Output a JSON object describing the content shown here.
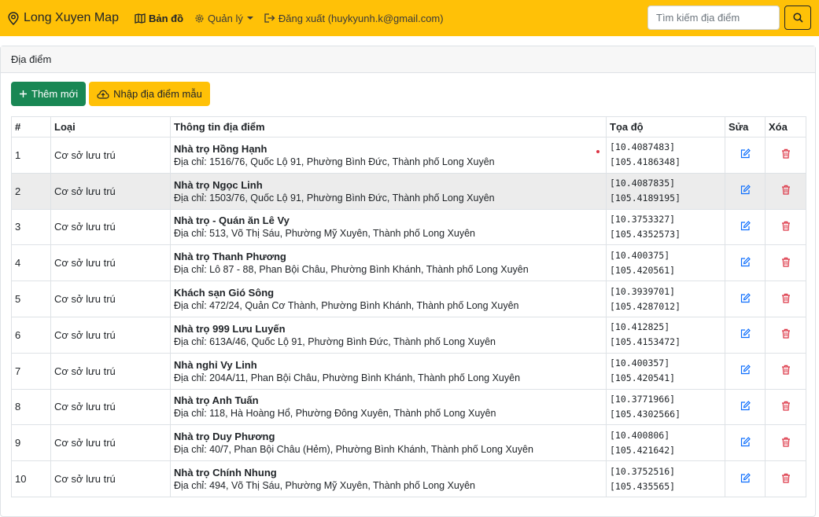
{
  "navbar": {
    "brand": "Long Xuyen Map",
    "map_label": "Bản đồ",
    "manage_label": "Quản lý",
    "logout_label": "Đăng xuất (huykyunh.k@gmail.com)",
    "search_placeholder": "Tìm kiếm địa điểm"
  },
  "card": {
    "title": "Địa điểm",
    "add_label": "Thêm mới",
    "import_label": "Nhập địa điểm mẫu"
  },
  "table": {
    "headers": [
      "#",
      "Loại",
      "Thông tin địa điểm",
      "Tọa độ",
      "Sửa",
      "Xóa"
    ],
    "rows": [
      {
        "no": "1",
        "type": "Cơ sở lưu trú",
        "name": "Nhà trọ Hồng Hạnh",
        "address": "Địa chỉ: 1516/76, Quốc Lộ 91, Phường Bình Đức, Thành phố Long Xuyên",
        "lat": "[10.4087483]",
        "lng": "[105.4186348]"
      },
      {
        "no": "2",
        "type": "Cơ sở lưu trú",
        "name": "Nhà trọ Ngọc Linh",
        "address": "Địa chỉ: 1503/76, Quốc Lộ 91, Phường Bình Đức, Thành phố Long Xuyên",
        "lat": "[10.4087835]",
        "lng": "[105.4189195]"
      },
      {
        "no": "3",
        "type": "Cơ sở lưu trú",
        "name": "Nhà trọ - Quán ăn Lê Vy",
        "address": "Địa chỉ: 513, Võ Thị Sáu, Phường Mỹ Xuyên, Thành phố Long Xuyên",
        "lat": "[10.3753327]",
        "lng": "[105.4352573]"
      },
      {
        "no": "4",
        "type": "Cơ sở lưu trú",
        "name": "Nhà trọ Thanh Phương",
        "address": "Địa chỉ: Lô 87 - 88, Phan Bội Châu, Phường Bình Khánh, Thành phố Long Xuyên",
        "lat": "[10.400375]",
        "lng": "[105.420561]"
      },
      {
        "no": "5",
        "type": "Cơ sở lưu trú",
        "name": "Khách sạn Gió Sông",
        "address": "Địa chỉ: 472/24, Quản Cơ Thành, Phường Bình Khánh, Thành phố Long Xuyên",
        "lat": "[10.3939701]",
        "lng": "[105.4287012]"
      },
      {
        "no": "6",
        "type": "Cơ sở lưu trú",
        "name": "Nhà trọ 999 Lưu Luyến",
        "address": "Địa chỉ: 613A/46, Quốc Lộ 91, Phường Bình Đức, Thành phố Long Xuyên",
        "lat": "[10.412825]",
        "lng": "[105.4153472]"
      },
      {
        "no": "7",
        "type": "Cơ sở lưu trú",
        "name": "Nhà nghỉ Vy Linh",
        "address": "Địa chỉ: 204A/11, Phan Bội Châu, Phường Bình Khánh, Thành phố Long Xuyên",
        "lat": "[10.400357]",
        "lng": "[105.420541]"
      },
      {
        "no": "8",
        "type": "Cơ sở lưu trú",
        "name": "Nhà trọ Anh Tuấn",
        "address": "Địa chỉ: 118, Hà Hoàng Hổ, Phường Đông Xuyên, Thành phố Long Xuyên",
        "lat": "[10.3771966]",
        "lng": "[105.4302566]"
      },
      {
        "no": "9",
        "type": "Cơ sở lưu trú",
        "name": "Nhà trọ Duy Phương",
        "address": "Địa chỉ: 40/7, Phan Bội Châu (Hẻm), Phường Bình Khánh, Thành phố Long Xuyên",
        "lat": "[10.400806]",
        "lng": "[105.421642]"
      },
      {
        "no": "10",
        "type": "Cơ sở lưu trú",
        "name": "Nhà trọ Chính Nhung",
        "address": "Địa chỉ: 494, Võ Thị Sáu, Phường Mỹ Xuyên, Thành phố Long Xuyên",
        "lat": "[10.3752516]",
        "lng": "[105.435565]"
      }
    ]
  },
  "colors": {
    "navbar": "#ffc107",
    "add_button": "#198754",
    "edit_icon": "#0d6efd",
    "delete_icon": "#dc3545"
  }
}
